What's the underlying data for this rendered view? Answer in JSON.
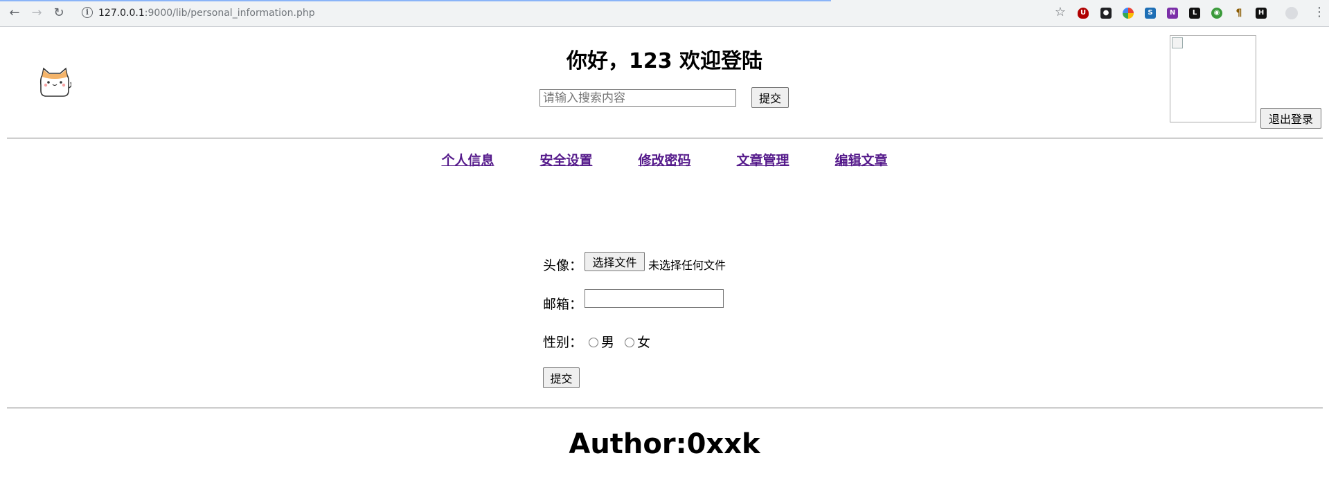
{
  "browser": {
    "url_host": "127.0.0.1",
    "url_rest": ":9000/lib/personal_information.php",
    "colors": {
      "accent": "#8ab4f8",
      "chrome_bg": "#f1f3f4"
    }
  },
  "header": {
    "greeting": "你好，123 欢迎登陆",
    "search": {
      "placeholder": "请输入搜索内容",
      "submit_label": "提交"
    },
    "logout_label": "退出登录"
  },
  "nav": {
    "items": [
      {
        "label": "个人信息"
      },
      {
        "label": "安全设置"
      },
      {
        "label": "修改密码"
      },
      {
        "label": "文章管理"
      },
      {
        "label": "编辑文章"
      }
    ],
    "link_color": "#551a8b"
  },
  "form": {
    "avatar_label": "头像：",
    "choose_file_label": "选择文件",
    "no_file_text": "未选择任何文件",
    "email_label": "邮箱：",
    "email_value": "",
    "gender_label": "性别：",
    "gender_options": [
      "男",
      "女"
    ],
    "submit_label": "提交"
  },
  "footer": {
    "author": "Author:0xxk"
  }
}
